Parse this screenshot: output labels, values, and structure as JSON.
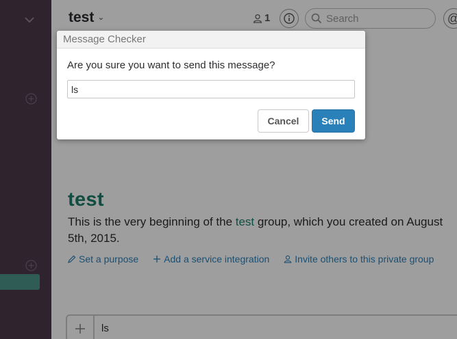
{
  "colors": {
    "sidebar_bg": "#4d394b",
    "sidebar_active": "#4c9689",
    "channel_green": "#1d7d6b",
    "link_blue": "#2a80b9",
    "send_button": "#2a80b9"
  },
  "sidebar": {
    "icons": [
      "chevron-down-icon",
      "add-channel-icon",
      "add-dm-icon"
    ]
  },
  "header": {
    "channel_name": "test",
    "caret": "⌄",
    "member_count": "1",
    "search_placeholder": "Search",
    "at_symbol": "@"
  },
  "intro": {
    "title": "test",
    "text_before": "This is the very beginning of the ",
    "channel_link": "test",
    "text_after": " group, which you created on August 5th, 2015.",
    "actions": {
      "set_purpose": "Set a purpose",
      "add_integration": "Add a service integration",
      "invite": "Invite others to this private group"
    }
  },
  "message_input": {
    "value": "ls"
  },
  "dialog": {
    "title": "Message Checker",
    "question": "Are you sure you want to send this message?",
    "message_value": "ls",
    "cancel_label": "Cancel",
    "send_label": "Send"
  }
}
